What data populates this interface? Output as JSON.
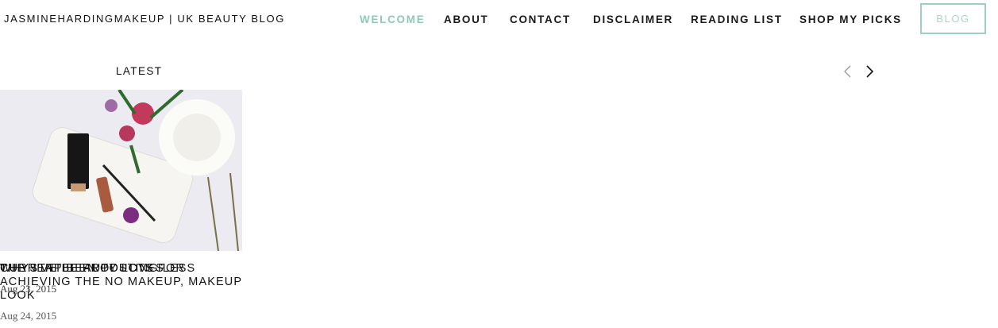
{
  "site": {
    "title": "JASMINEHARDINGMAKEUP | UK BEAUTY BLOG"
  },
  "nav": {
    "items": [
      {
        "label": "WELCOME",
        "active": true
      },
      {
        "label": "ABOUT",
        "active": false
      },
      {
        "label": "CONTACT",
        "active": false
      },
      {
        "label": "DISCLAIMER",
        "active": false
      },
      {
        "label": "READING LIST",
        "active": false
      },
      {
        "label": "SHOP MY PICKS",
        "active": false
      }
    ],
    "blog_button": "BLOG"
  },
  "colors": {
    "accent": "#8fc9b6",
    "text": "#111111",
    "date": "#555555"
  },
  "latest": {
    "heading": "LATEST",
    "prev_icon": "chevron-left-icon",
    "next_icon": "chevron-right-icon",
    "posts": [
      {
        "title": "THE STAPLE PRODUCTS FOR ACHIEVING THE NO MAKEUP, MAKEUP LOOK",
        "date": "Aug 24, 2015"
      },
      {
        "title": "WHY I'VE BEEN POSTING LESS",
        "date": "Aug 23, 2015"
      },
      {
        "title": "CURRENT BEAUTY LOVES",
        "date": "Aug 21, 2015"
      }
    ]
  }
}
